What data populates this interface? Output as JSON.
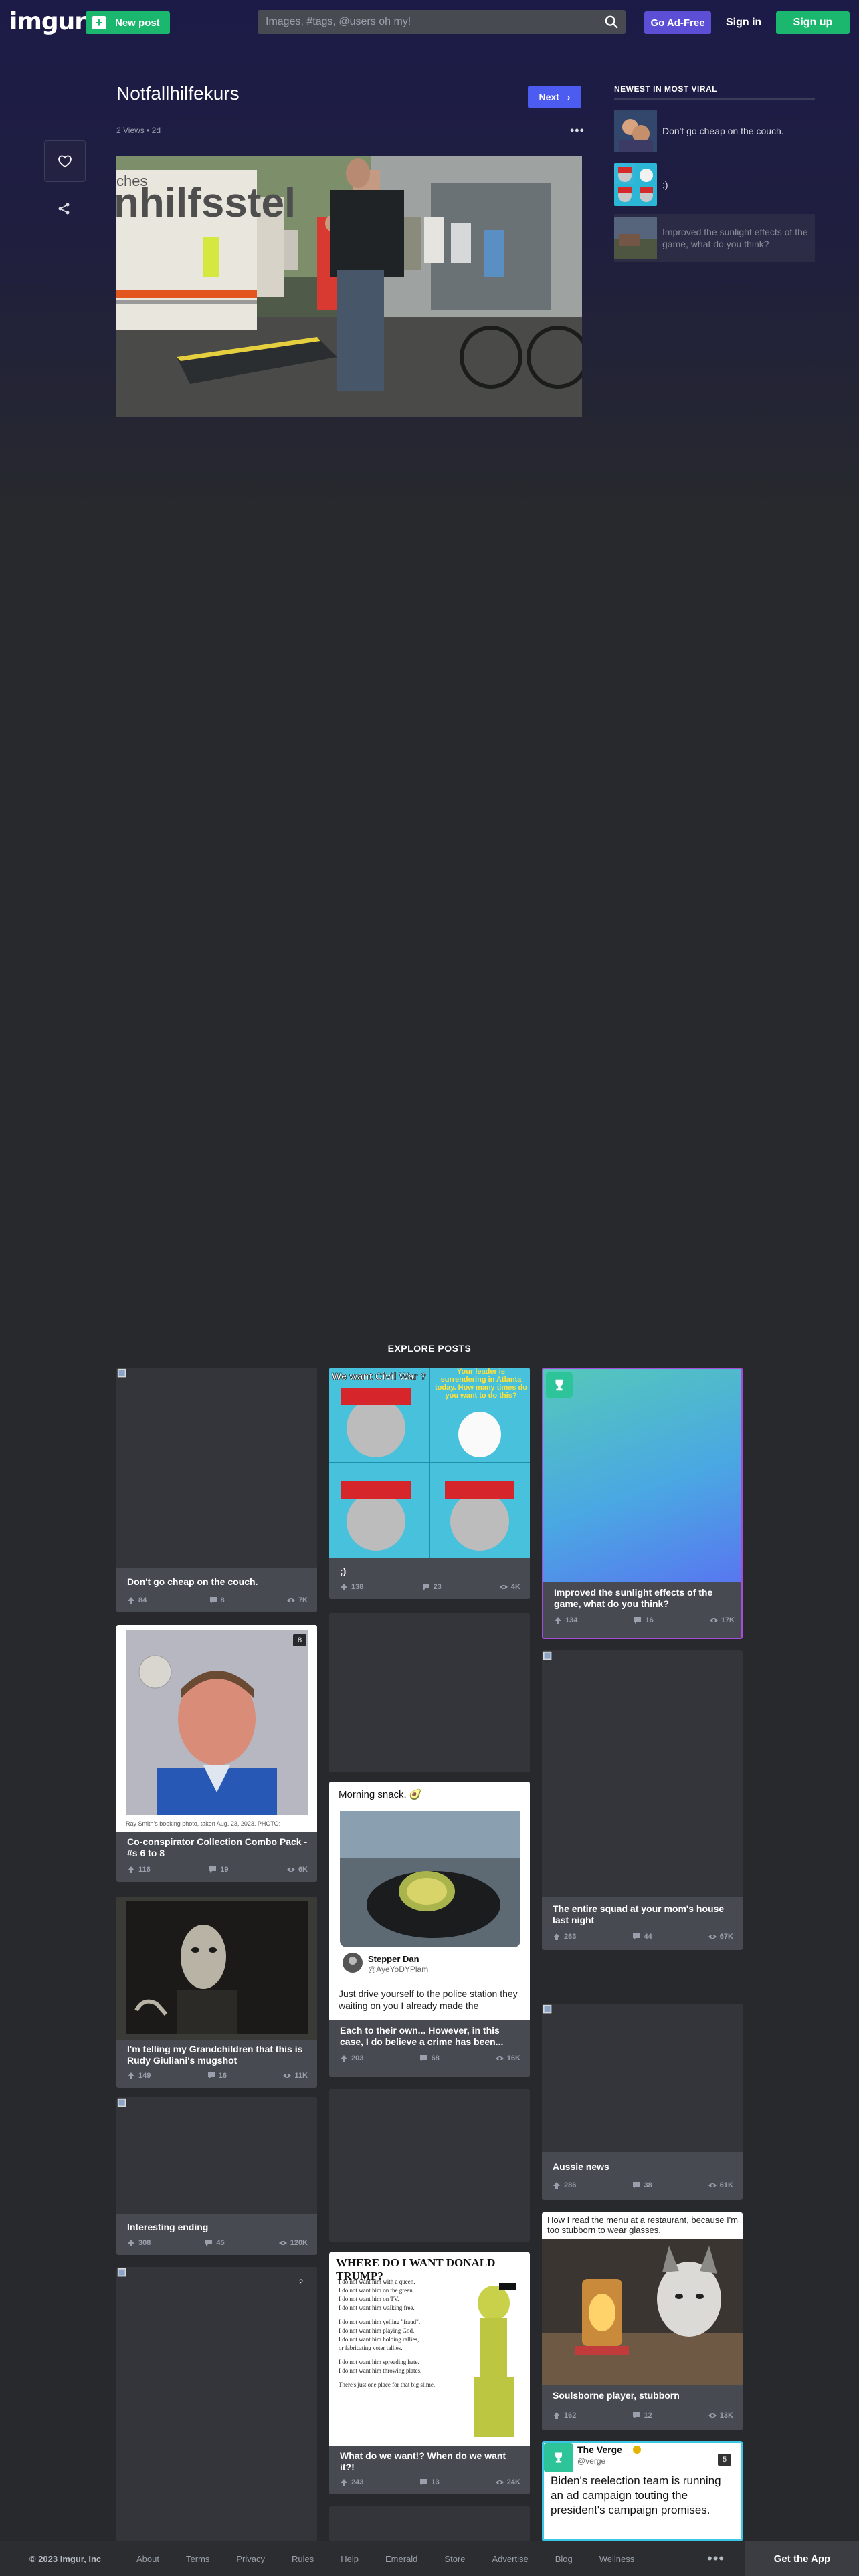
{
  "header": {
    "logo": "imgur",
    "new_post": "New post",
    "search_placeholder": "Images, #tags, @users oh my!",
    "ad_free": "Go Ad-Free",
    "sign_in": "Sign in",
    "sign_up": "Sign up"
  },
  "post": {
    "title": "Notfallhilfekurs",
    "meta": "2 Views • 2d",
    "next": "Next",
    "image_sign_text": "nhilfsstel",
    "image_sign_text_top": "ches"
  },
  "sidebar": {
    "heading": "NEWEST IN MOST VIRAL",
    "items": [
      {
        "label": "Don't go cheap on the couch."
      },
      {
        "label": ";)"
      },
      {
        "label": "Improved the sunlight effects of the game, what do you think?"
      }
    ]
  },
  "explore": {
    "heading": "EXPLORE POSTS",
    "cards": [
      {
        "title": "Don't go cheap on the couch.",
        "upvotes": "84",
        "comments": "8",
        "views": "7K"
      },
      {
        "title": ";)",
        "upvotes": "138",
        "comments": "23",
        "views": "4K",
        "meme_text_1": "We want Civil War ?",
        "meme_text_2": "Your leader is surrendering in Atlanta today. How many times do you want to do this?"
      },
      {
        "title": "Improved the sunlight effects of the game, what do you think?",
        "upvotes": "134",
        "comments": "16",
        "views": "17K"
      },
      {
        "title": "Co-conspirator Collection Combo Pack - #s 6 to 8",
        "upvotes": "116",
        "comments": "19",
        "views": "6K",
        "badge": "8",
        "caption": "Ray Smith's booking photo, taken Aug. 23, 2023. PHOTO:"
      },
      {
        "title": "The entire squad at your mom's house last night",
        "upvotes": "263",
        "comments": "44",
        "views": "67K"
      },
      {
        "title": "Each to their own... However, in this case, I do believe a crime has been...",
        "upvotes": "203",
        "comments": "68",
        "views": "16K",
        "tweet_text": "Morning snack. 🥑",
        "user_name": "Stepper Dan",
        "user_handle": "@AyeYoDYPlam",
        "reply_text": "Just drive yourself to the police station they waiting on you I already made the"
      },
      {
        "title": "I'm telling my Grandchildren that this is Rudy Giuliani's mugshot",
        "upvotes": "149",
        "comments": "16",
        "views": "11K"
      },
      {
        "title": "Aussie news",
        "upvotes": "286",
        "comments": "38",
        "views": "61K"
      },
      {
        "title": "Interesting ending",
        "upvotes": "308",
        "comments": "45",
        "views": "120K"
      },
      {
        "title": "Soulsborne player, stubborn",
        "upvotes": "162",
        "comments": "12",
        "views": "13K",
        "meme_text": "How I read the menu at a restaurant, because I'm too stubborn to wear glasses."
      },
      {
        "title": "What do we want!? When do we want it?!",
        "upvotes": "243",
        "comments": "13",
        "views": "24K",
        "poster_title": "WHERE DO I WANT DONALD TRUMP?",
        "poster_lines": [
          "I do not want him with a queen.",
          "I do not want him on the green.",
          "I do not want him on TV.",
          "I do not want him walking free.",
          "I do not want him yelling \"fraud\".",
          "I do not want him playing God.",
          "I do not want him holding rallies,",
          "or fabricating voter tallies.",
          "I do not want him spreading hate.",
          "I do not want him throwing plates.",
          "There's just one place for that big slime."
        ]
      },
      {
        "badge": "5",
        "source": "The Verge",
        "handle": "@verge",
        "headline": "Biden's reelection team is running an ad campaign touting the president's campaign promises."
      },
      {
        "badge": "2"
      }
    ]
  },
  "footer": {
    "copyright": "© 2023 Imgur, Inc",
    "links": [
      "About",
      "Terms",
      "Privacy",
      "Rules",
      "Help",
      "Emerald",
      "Store",
      "Advertise",
      "Blog",
      "Wellness"
    ],
    "get_app": "Get the App"
  },
  "colors": {
    "brand_green": "#1bb76e",
    "ad_free_purple": "#5c4fd6",
    "next_blue": "#4c5bf0",
    "card_bg": "#474a51",
    "page_bg": "#27292d"
  }
}
